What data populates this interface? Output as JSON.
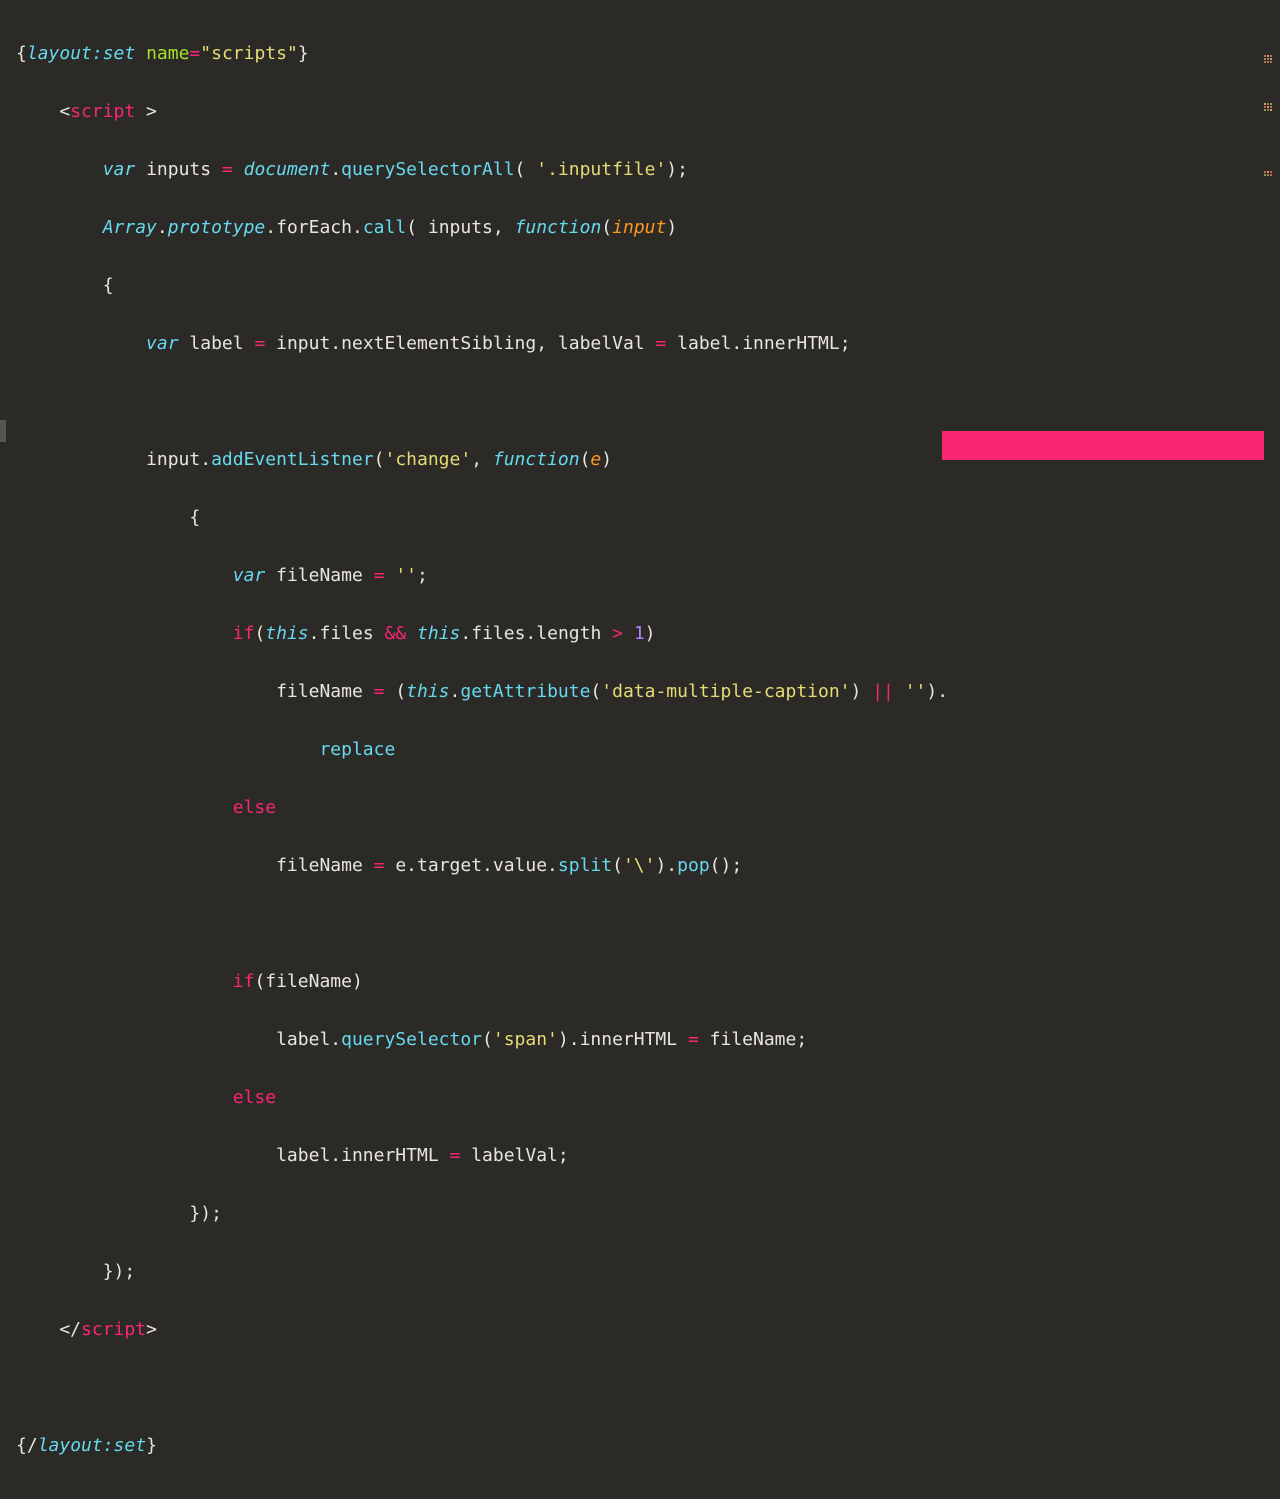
{
  "colors": {
    "bg": "#2b2a27",
    "selection": "#f92672",
    "keyword": "#f92672",
    "storage": "#66d9ef",
    "string": "#e6db74",
    "number": "#ae81ff",
    "param": "#fd971f",
    "ident": "#a6e22e",
    "plain": "#e8e6dc"
  },
  "code": {
    "l1_open_brace": "{",
    "l1_layout": "layout:set",
    "l1_name": "name",
    "l1_eq": "=",
    "l1_str": "\"scripts\"",
    "l1_close_brace": "}",
    "l2_lt": "    <",
    "l2_tag": "script",
    "l2_gtspace": " >",
    "l3_indent": "        ",
    "l3_var": "var ",
    "l3_inputs": "inputs ",
    "l3_eq": "= ",
    "l3_doc": "document",
    "l3_dot1": ".",
    "l3_qsa": "querySelectorAll",
    "l3_open": "( ",
    "l3_str": "'.inputfile'",
    "l3_close": ");",
    "l4_indent": "        ",
    "l4_arr": "Array",
    "l4_dot1": ".",
    "l4_proto": "prototype",
    "l4_dot2": ".",
    "l4_foreach": "forEach",
    "l4_dot3": ".",
    "l4_call": "call",
    "l4_open": "( ",
    "l4_inputs": "inputs",
    "l4_comma": ", ",
    "l4_func": "function",
    "l4_popen": "(",
    "l4_param": "input",
    "l4_pclose": ")",
    "l5": "        {",
    "l6_indent": "            ",
    "l6_var": "var ",
    "l6_label": "label ",
    "l6_eq": "= ",
    "l6_input": "input.",
    "l6_nes": "nextElementSibling",
    "l6_comma": ", ",
    "l6_lv": "labelVal ",
    "l6_eq2": "= ",
    "l6_labeldot": "label.",
    "l6_inner": "innerHTML",
    "l6_semi": ";",
    "l7": "",
    "l8_indent": "            ",
    "l8_input": "input.",
    "l8_ael": "addEventListner",
    "l8_open": "(",
    "l8_str": "'change'",
    "l8_comma": ", ",
    "l8_func": "function",
    "l8_popen": "(",
    "l8_param": "e",
    "l8_pclose": ")",
    "l9": "                {",
    "l10_indent": "                    ",
    "l10_var": "var ",
    "l10_fn": "fileName ",
    "l10_eq": "= ",
    "l10_str": "''",
    "l10_semi": ";",
    "l11_indent": "                    ",
    "l11_if": "if",
    "l11_open": "(",
    "l11_this": "this",
    "l11_dot1": ".",
    "l11_files": "files ",
    "l11_and": "&& ",
    "l11_this2": "this",
    "l11_dot2": ".",
    "l11_files2": "files.",
    "l11_len": "length ",
    "l11_gt": "> ",
    "l11_num": "1",
    "l11_close": ")",
    "l12_indent": "                        ",
    "l12_fn": "fileName ",
    "l12_eq": "= ",
    "l12_open": "(",
    "l12_this": "this",
    "l12_dot": ".",
    "l12_ga": "getAttribute",
    "l12_popen": "(",
    "l12_str": "'data-multiple-caption'",
    "l12_pclose": ") ",
    "l12_or": "|| ",
    "l12_empty": "''",
    "l12_cdot": ").",
    "l13_indent": "                            ",
    "l13_repl": "replace",
    "l14_indent": "                    ",
    "l14_else": "else",
    "l15_indent": "                        ",
    "l15_fn": "fileName ",
    "l15_eq": "= ",
    "l15_e": "e.",
    "l15_target": "target.",
    "l15_value": "value.",
    "l15_split": "split",
    "l15_open": "(",
    "l15_str": "'\\'",
    "l15_close": ").",
    "l15_pop": "pop",
    "l15_end": "();",
    "l16": "",
    "l17_indent": "                    ",
    "l17_if": "if",
    "l17_open": "(fileName)",
    "l18_indent": "                        ",
    "l18_label": "label.",
    "l18_qs": "querySelector",
    "l18_open": "(",
    "l18_str": "'span'",
    "l18_close": ").",
    "l18_inner": "innerHTML ",
    "l18_eq": "= ",
    "l18_fn": "fileName;",
    "l19_indent": "                    ",
    "l19_else": "else",
    "l20_indent": "                        ",
    "l20_label": "label.",
    "l20_inner": "innerHTML ",
    "l20_eq": "= ",
    "l20_lv": "labelVal;",
    "l21": "                });",
    "l22": "        });",
    "l23_lt": "    </",
    "l23_tag": "script",
    "l23_gt": ">",
    "l24": "",
    "l25_open": "{/",
    "l25_layout": "layout:set",
    "l25_close": "}"
  }
}
